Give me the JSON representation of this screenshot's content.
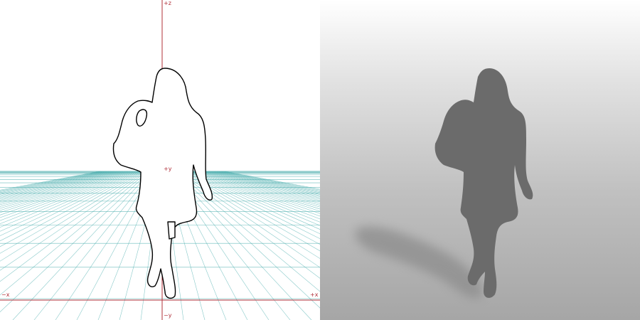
{
  "viewport_left": {
    "axis_labels": {
      "plus_z": "+z",
      "plus_y": "+y",
      "minus_x": "−x",
      "plus_x": "+x",
      "minus_y": "−y"
    },
    "colors": {
      "axis": "#b0303a",
      "grid": "#3aa6a6",
      "outline": "#000000",
      "background": "#ffffff"
    }
  },
  "viewport_right": {
    "colors": {
      "silhouette": "#6b6b6b",
      "shadow": "#8c8c8c",
      "background_top": "#ffffff",
      "background_bottom": "#a6a6a6"
    }
  }
}
